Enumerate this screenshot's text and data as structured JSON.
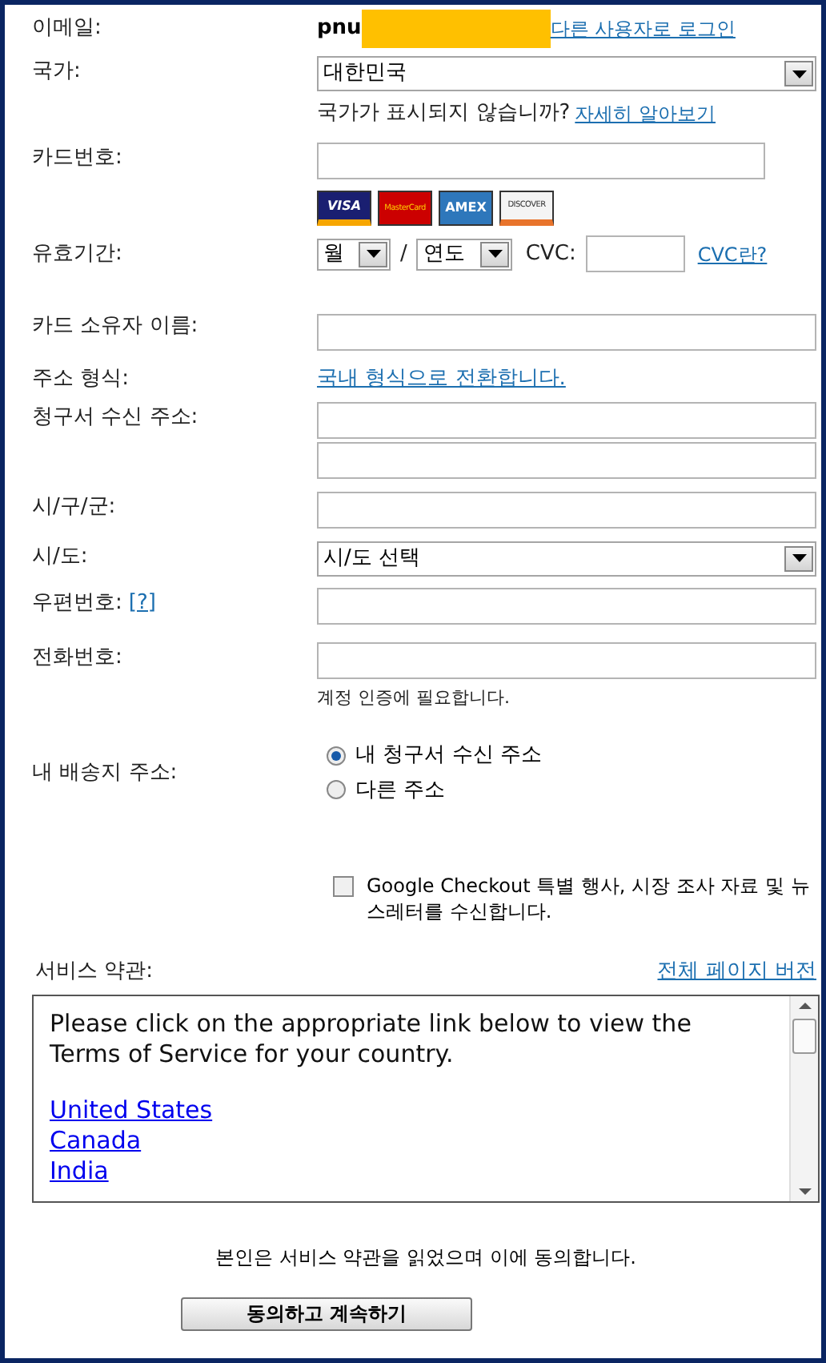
{
  "email": {
    "label": "이메일:",
    "value": "pnu",
    "link": "다른 사용자로 로그인"
  },
  "country": {
    "label": "국가:",
    "value": "대한민국",
    "note": "국가가 표시되지 않습니까?",
    "note_link": "자세히 알아보기"
  },
  "card_number": {
    "label": "카드번호:",
    "logos": [
      "VISA",
      "MasterCard",
      "AMEX",
      "DISCOVER"
    ]
  },
  "expiry": {
    "label": "유효기간:",
    "month": "월",
    "separator": "/",
    "year": "연도",
    "cvc_label": "CVC:",
    "cvc_link": "CVC란?"
  },
  "cardholder": {
    "label": "카드 소유자 이름:"
  },
  "address_format": {
    "label": "주소 형식:",
    "link": "국내 형식으로 전환합니다."
  },
  "billing_address": {
    "label": "청구서 수신 주소:"
  },
  "city": {
    "label": "시/구/군:"
  },
  "province": {
    "label": "시/도:",
    "value": "시/도 선택"
  },
  "postal": {
    "label": "우편번호:",
    "help": "[?]"
  },
  "phone": {
    "label": "전화번호:",
    "note": "계정 인증에 필요합니다."
  },
  "shipping": {
    "label": "내 배송지 주소:",
    "options": [
      {
        "label": "내 청구서 수신 주소",
        "selected": true
      },
      {
        "label": "다른 주소",
        "selected": false
      }
    ]
  },
  "newsletter": {
    "checked": false,
    "label": "Google Checkout 특별 행사, 시장 조사 자료 및 뉴스레터를 수신합니다."
  },
  "terms": {
    "label": "서비스 약관:",
    "link": "전체 페이지 버전",
    "text": "Please click on the appropriate link below to view the Terms of Service for your country.",
    "countries": [
      "United States",
      "Canada",
      "India"
    ]
  },
  "agreement": "본인은 서비스 약관을 읽었으며 이에 동의합니다.",
  "submit": "동의하고 계속하기"
}
